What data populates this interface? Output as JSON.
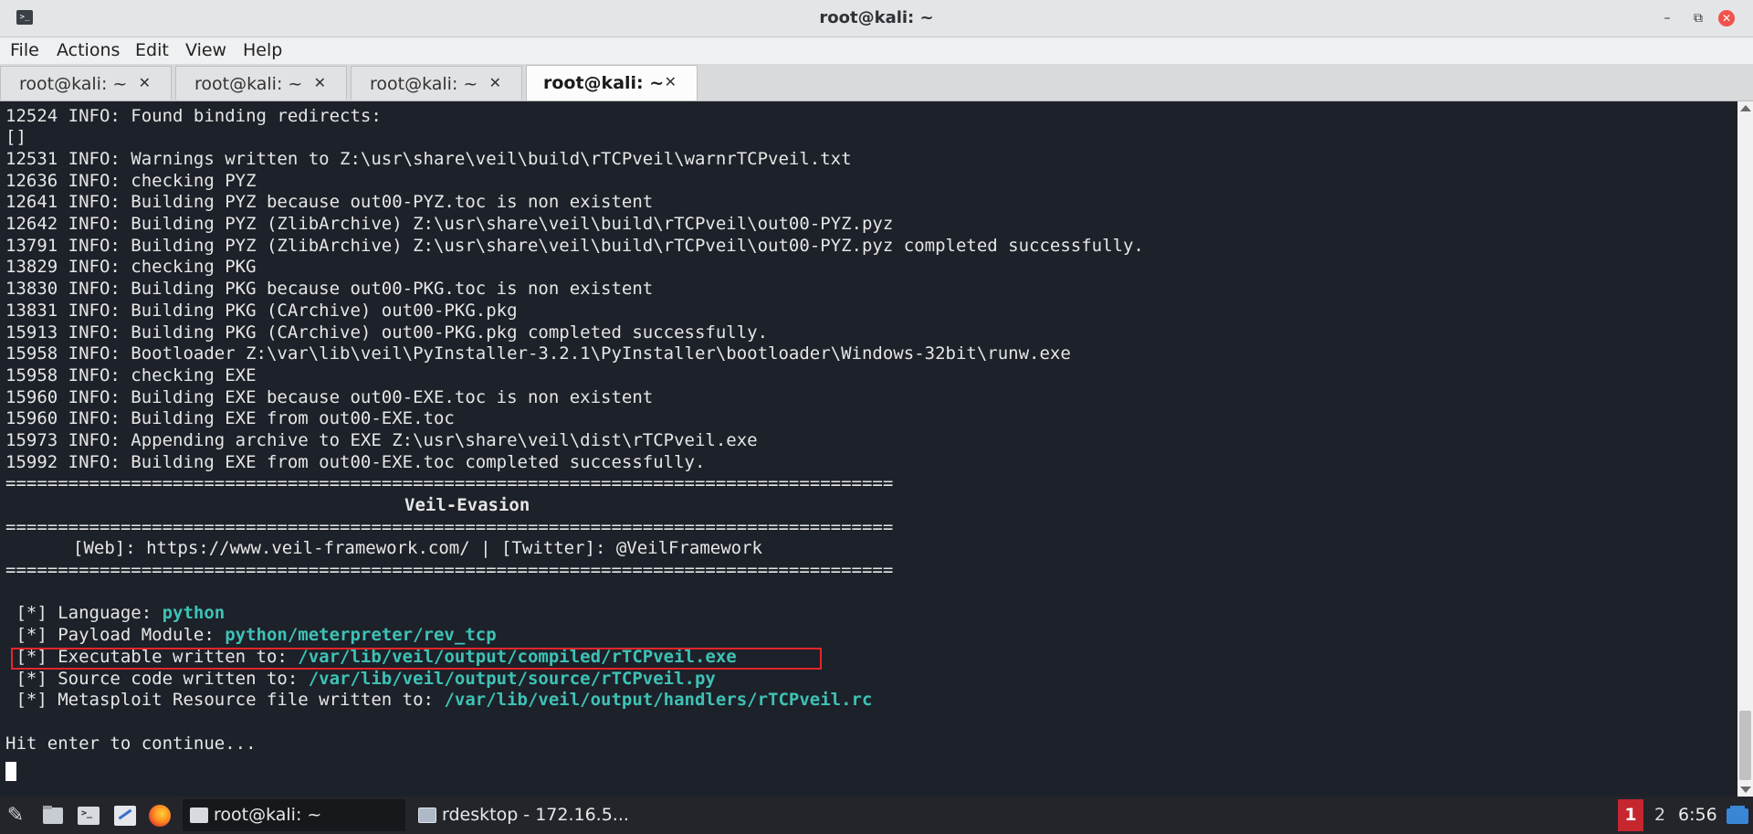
{
  "window": {
    "title": "root@kali: ~",
    "controls": {
      "minimize": "–",
      "maximize": "⧉",
      "close": "✕"
    }
  },
  "menu": [
    "File",
    "Actions",
    "Edit",
    "View",
    "Help"
  ],
  "tabs": [
    {
      "label": "root@kali: ~",
      "active": false
    },
    {
      "label": "root@kali: ~",
      "active": false
    },
    {
      "label": "root@kali: ~",
      "active": false
    },
    {
      "label": "root@kali: ~",
      "active": true
    }
  ],
  "tab_close_glyph": "✕",
  "terminal": {
    "lines": [
      "12524 INFO: Found binding redirects:",
      "[]",
      "12531 INFO: Warnings written to Z:\\usr\\share\\veil\\build\\rTCPveil\\warnrTCPveil.txt",
      "12636 INFO: checking PYZ",
      "12641 INFO: Building PYZ because out00-PYZ.toc is non existent",
      "12642 INFO: Building PYZ (ZlibArchive) Z:\\usr\\share\\veil\\build\\rTCPveil\\out00-PYZ.pyz",
      "13791 INFO: Building PYZ (ZlibArchive) Z:\\usr\\share\\veil\\build\\rTCPveil\\out00-PYZ.pyz completed successfully.",
      "13829 INFO: checking PKG",
      "13830 INFO: Building PKG because out00-PKG.toc is non existent",
      "13831 INFO: Building PKG (CArchive) out00-PKG.pkg",
      "15913 INFO: Building PKG (CArchive) out00-PKG.pkg completed successfully.",
      "15958 INFO: Bootloader Z:\\var\\lib\\veil\\PyInstaller-3.2.1\\PyInstaller\\bootloader\\Windows-32bit\\runw.exe",
      "15958 INFO: checking EXE",
      "15960 INFO: Building EXE because out00-EXE.toc is non existent",
      "15960 INFO: Building EXE from out00-EXE.toc",
      "15973 INFO: Appending archive to EXE Z:\\usr\\share\\veil\\dist\\rTCPveil.exe",
      "15992 INFO: Building EXE from out00-EXE.toc completed successfully."
    ],
    "separator": "=====================================================================================",
    "banner_title": "Veil-Evasion",
    "banner_links": "[Web]: https://www.veil-framework.com/ | [Twitter]: @VeilFramework",
    "results": [
      {
        "prefix": " [*] Language: ",
        "value": "python"
      },
      {
        "prefix": " [*] Payload Module: ",
        "value": "python/meterpreter/rev_tcp"
      },
      {
        "prefix": " [*] Executable written to: ",
        "value": "/var/lib/veil/output/compiled/rTCPveil.exe",
        "highlighted": true
      },
      {
        "prefix": " [*] Source code written to: ",
        "value": "/var/lib/veil/output/source/rTCPveil.py"
      },
      {
        "prefix": " [*] Metasploit Resource file written to: ",
        "value": "/var/lib/veil/output/handlers/rTCPveil.rc"
      }
    ],
    "prompt": "Hit enter to continue...",
    "colors": {
      "background": "#1d2129",
      "text": "#e6e6e6",
      "path": "#3ec2b6",
      "highlight_box": "#e3262a"
    }
  },
  "taskbar": {
    "launchers": [
      "kali-menu-icon",
      "file-manager-icon",
      "terminal-icon",
      "text-editor-icon",
      "firefox-icon"
    ],
    "kali_glyph": "✎",
    "term_glyph": ">_",
    "tasks": [
      {
        "label": "root@kali: ~",
        "active": true
      },
      {
        "label": "rdesktop - 172.16.5...",
        "active": false
      }
    ],
    "workspaces": [
      "1",
      "2"
    ],
    "active_workspace": "1",
    "clock": "6:56"
  }
}
